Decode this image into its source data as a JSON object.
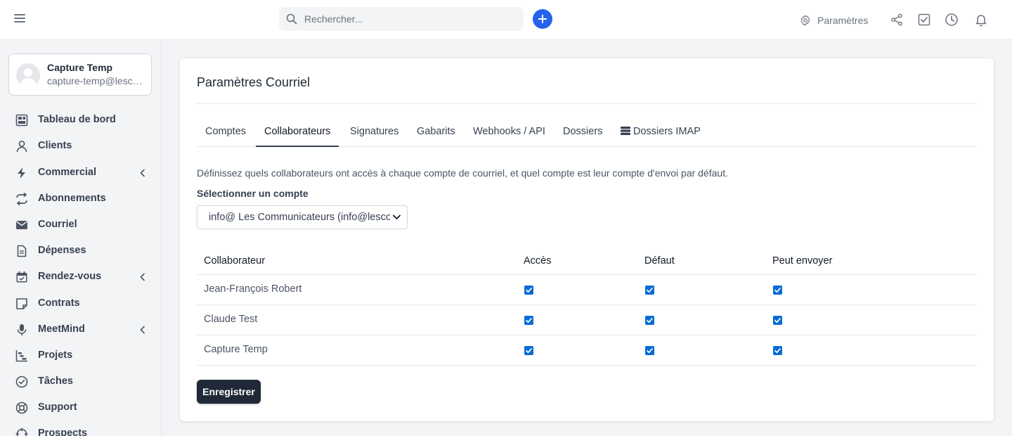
{
  "topbar": {
    "search_placeholder": "Rechercher...",
    "settings_label": "Paramètres",
    "accent": "#2563eb"
  },
  "sidebar": {
    "profile": {
      "name": "Capture Temp",
      "email": "capture-temp@lescommunicateurs.com"
    },
    "items": [
      {
        "label": "Tableau de bord",
        "icon": "dashboard-icon",
        "expandable": false
      },
      {
        "label": "Clients",
        "icon": "user-icon",
        "expandable": false
      },
      {
        "label": "Commercial",
        "icon": "lightning-icon",
        "expandable": true
      },
      {
        "label": "Abonnements",
        "icon": "repeat-icon",
        "expandable": false
      },
      {
        "label": "Courriel",
        "icon": "mail-icon",
        "expandable": false
      },
      {
        "label": "Dépenses",
        "icon": "document-icon",
        "expandable": false
      },
      {
        "label": "Rendez-vous",
        "icon": "calendar-icon",
        "expandable": true
      },
      {
        "label": "Contrats",
        "icon": "note-icon",
        "expandable": false
      },
      {
        "label": "MeetMind",
        "icon": "microphone-icon",
        "expandable": true
      },
      {
        "label": "Projets",
        "icon": "gantt-icon",
        "expandable": false
      },
      {
        "label": "Tâches",
        "icon": "check-circle-icon",
        "expandable": false
      },
      {
        "label": "Support",
        "icon": "lifebuoy-icon",
        "expandable": false
      },
      {
        "label": "Prospects",
        "icon": "crosshair-icon",
        "expandable": false
      }
    ]
  },
  "main": {
    "title": "Paramètres Courriel",
    "tabs": [
      {
        "label": "Comptes",
        "active": false
      },
      {
        "label": "Collaborateurs",
        "active": true
      },
      {
        "label": "Signatures",
        "active": false
      },
      {
        "label": "Gabarits",
        "active": false
      },
      {
        "label": "Webhooks / API",
        "active": false
      },
      {
        "label": "Dossiers",
        "active": false
      },
      {
        "label": "Dossiers IMAP",
        "active": false,
        "icon": "database-icon"
      }
    ],
    "description": "Définissez quels collaborateurs ont accès à chaque compte de courriel, et quel compte est leur compte d'envoi par défaut.",
    "select_label": "Sélectionner un compte",
    "selected_account": "info@ Les Communicateurs (info@lescommunicateurs.com)",
    "table": {
      "headers": [
        "Collaborateur",
        "Accès",
        "Défaut",
        "Peut envoyer"
      ],
      "rows": [
        {
          "name": "Jean-François Robert",
          "access": true,
          "default": true,
          "can_send": true
        },
        {
          "name": "Claude Test",
          "access": true,
          "default": true,
          "can_send": true
        },
        {
          "name": "Capture Temp",
          "access": true,
          "default": true,
          "can_send": true
        }
      ]
    },
    "save_label": "Enregistrer"
  }
}
